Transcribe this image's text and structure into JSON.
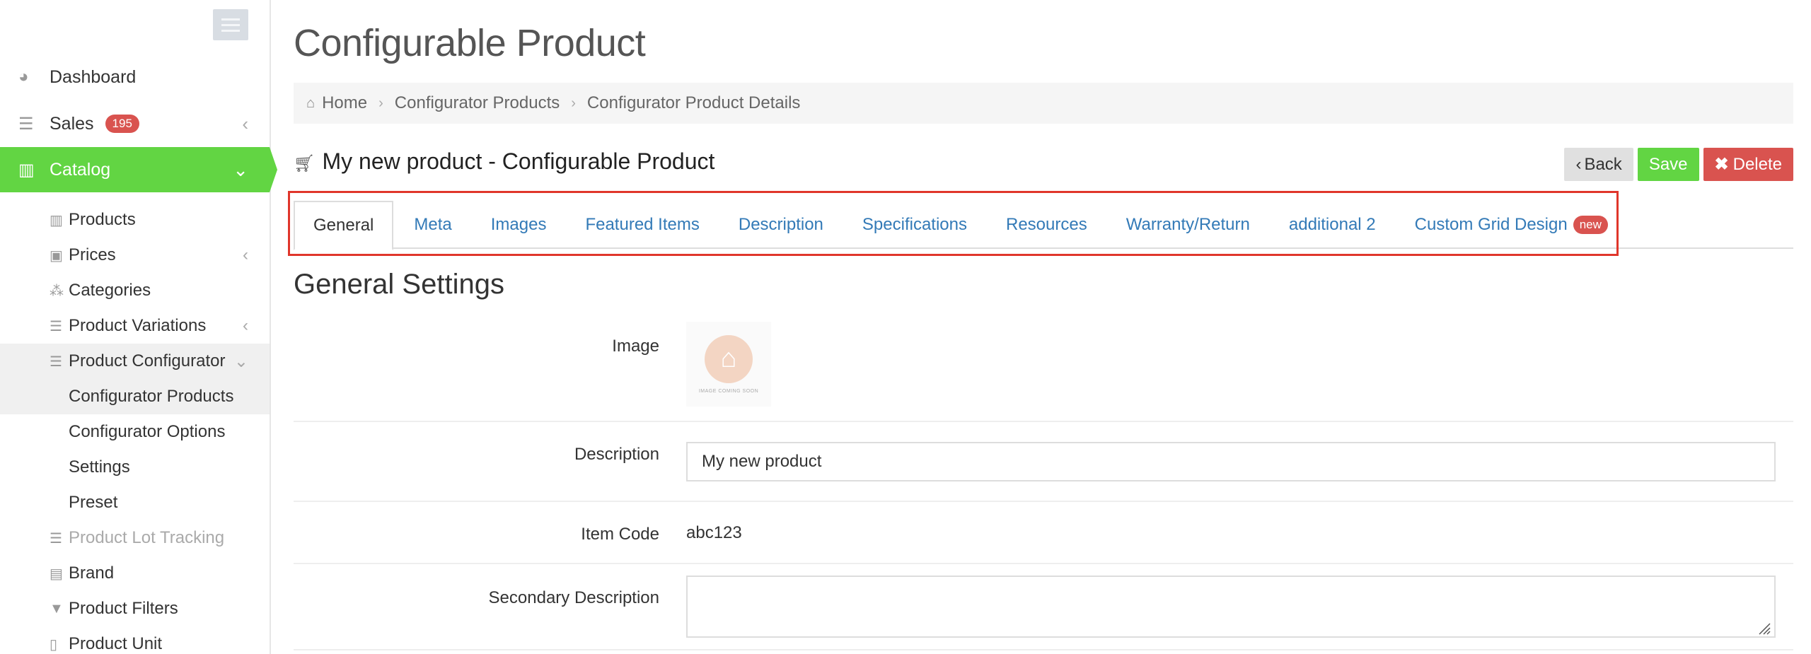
{
  "sidebar": {
    "items": [
      {
        "label": "Dashboard",
        "icon": "dashboard-icon"
      },
      {
        "label": "Sales",
        "badge": "195",
        "icon": "sales-icon"
      },
      {
        "label": "Catalog",
        "icon": "catalog-icon"
      }
    ],
    "catalog_items": [
      {
        "label": "Products"
      },
      {
        "label": "Prices"
      },
      {
        "label": "Categories"
      },
      {
        "label": "Product Variations"
      },
      {
        "label": "Product Configurator"
      },
      {
        "label": "Configurator Products"
      },
      {
        "label": "Configurator Options"
      },
      {
        "label": "Settings"
      },
      {
        "label": "Preset"
      },
      {
        "label": "Product Lot Tracking"
      },
      {
        "label": "Brand"
      },
      {
        "label": "Product Filters"
      },
      {
        "label": "Product Unit"
      }
    ],
    "accent_color": "#62d543"
  },
  "header": {
    "title": "Configurable Product"
  },
  "breadcrumb": [
    "Home",
    "Configurator Products",
    "Configurator Product Details"
  ],
  "product": {
    "title": "My new product - Configurable Product"
  },
  "actions": {
    "back": "Back",
    "save": "Save",
    "delete": "Delete"
  },
  "tabs": [
    {
      "label": "General"
    },
    {
      "label": "Meta"
    },
    {
      "label": "Images"
    },
    {
      "label": "Featured Items"
    },
    {
      "label": "Description"
    },
    {
      "label": "Specifications"
    },
    {
      "label": "Resources"
    },
    {
      "label": "Warranty/Return"
    },
    {
      "label": "additional 2"
    },
    {
      "label": "Custom Grid Design",
      "badge": "new"
    }
  ],
  "general": {
    "section_title": "General Settings",
    "image_label": "Image",
    "image_caption": "IMAGE COMING SOON",
    "description_label": "Description",
    "description_value": "My new product",
    "item_code_label": "Item Code",
    "item_code_value": "abc123",
    "secondary_description_label": "Secondary Description",
    "secondary_description_value": ""
  }
}
